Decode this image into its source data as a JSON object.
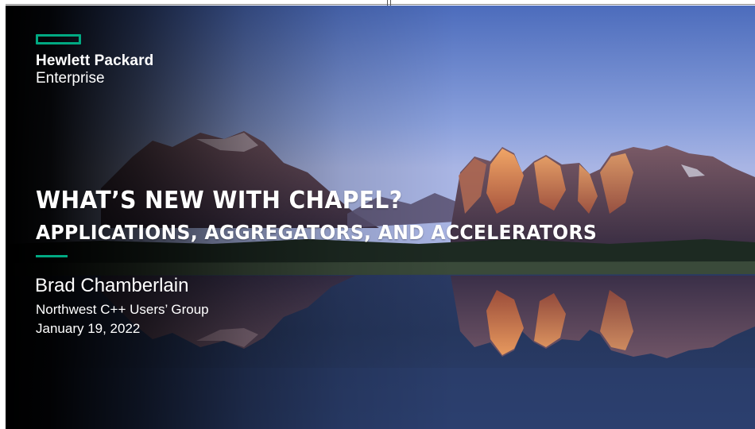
{
  "logo": {
    "line1": "Hewlett Packard",
    "line2": "Enterprise",
    "accent_color": "#01a982"
  },
  "slide": {
    "title": "WHAT’S NEW WITH CHAPEL?",
    "subtitle": "APPLICATIONS, AGGREGATORS, AND ACCELERATORS",
    "presenter": "Brad Chamberlain",
    "event": "Northwest C++ Users’ Group",
    "date": "January 19, 2022",
    "background": "mountain-lake-reflection-photo"
  },
  "colors": {
    "sky_top": "#4d6fbe",
    "sky_mid": "#8ea4de",
    "water": "#1a2a4a",
    "peak_lit": "#e08a52"
  }
}
